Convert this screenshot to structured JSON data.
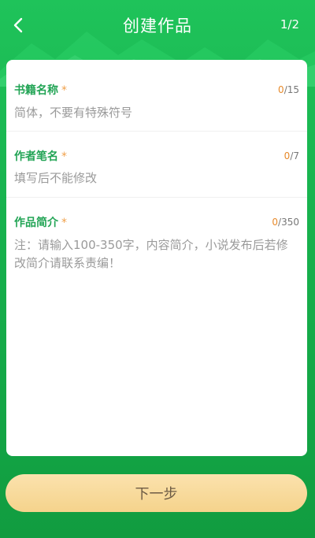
{
  "header": {
    "title": "创建作品",
    "step": "1/2"
  },
  "fields": [
    {
      "label": "书籍名称",
      "required_mark": "*",
      "count_current": "0",
      "count_max": "/15",
      "placeholder": "简体，不要有特殊符号"
    },
    {
      "label": "作者笔名",
      "required_mark": "*",
      "count_current": "0",
      "count_max": "/7",
      "placeholder": "填写后不能修改"
    },
    {
      "label": "作品简介",
      "required_mark": "*",
      "count_current": "0",
      "count_max": "/350",
      "placeholder": "注：请输入100-350字，内容简介，小说发布后若修改简介请联系责编！"
    }
  ],
  "footer": {
    "next_label": "下一步"
  }
}
